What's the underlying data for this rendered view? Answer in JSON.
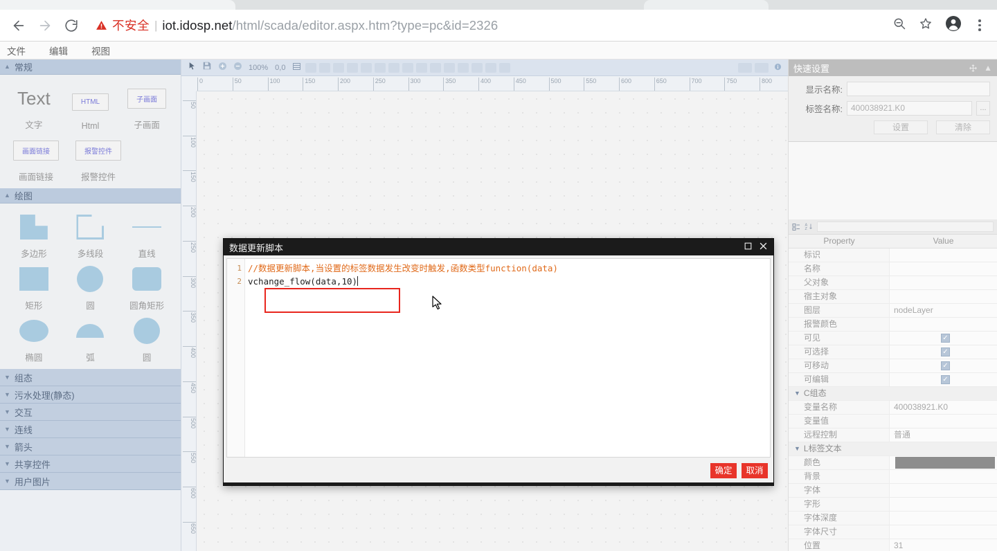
{
  "browser": {
    "back_icon": "arrow-left-icon",
    "forward_icon": "arrow-right-icon",
    "reload_icon": "reload-icon",
    "security_warning_icon": "warning-triangle-icon",
    "security_label": "不安全",
    "separator": "|",
    "url_host": "iot.idosp.net",
    "url_path": "/html/scada/editor.aspx.htm?type=pc&id=2326",
    "zoom_out_icon": "zoom-out-icon",
    "bookmark_icon": "star-icon",
    "profile_icon": "profile-avatar-icon",
    "menu_icon": "kebab-menu-icon"
  },
  "menubar": {
    "items": [
      {
        "label": "文件"
      },
      {
        "label": "编辑"
      },
      {
        "label": "视图"
      }
    ]
  },
  "palette": {
    "general": {
      "title": "常规",
      "expanded_icon": "triangle-up-icon",
      "rows": [
        [
          {
            "label": "文字",
            "glyph": "Text",
            "kind": "text"
          },
          {
            "label": "Html",
            "glyph": "HTML",
            "kind": "boxed"
          },
          {
            "label": "子画面",
            "glyph": "子画面",
            "kind": "boxed"
          }
        ],
        [
          {
            "label": "画面链接",
            "glyph": "画面链接",
            "kind": "boxed"
          },
          {
            "label": "报警控件",
            "glyph": "报警控件",
            "kind": "boxed"
          }
        ]
      ]
    },
    "drawing": {
      "title": "绘图",
      "expanded_icon": "triangle-up-icon",
      "rows": [
        [
          {
            "label": "多边形",
            "shape": "polygon"
          },
          {
            "label": "多线段",
            "shape": "polyline"
          },
          {
            "label": "直线",
            "shape": "line"
          }
        ],
        [
          {
            "label": "矩形",
            "shape": "rect"
          },
          {
            "label": "圆",
            "shape": "circle"
          },
          {
            "label": "圆角矩形",
            "shape": "roundrect"
          }
        ],
        [
          {
            "label": "椭圆",
            "shape": "ellipse"
          },
          {
            "label": "弧",
            "shape": "arc"
          },
          {
            "label": "圆",
            "shape": "circle"
          }
        ]
      ]
    },
    "collapsed_sections": [
      {
        "label": "组态",
        "icon": "triangle-down-icon"
      },
      {
        "label": "污水处理(静态)",
        "icon": "triangle-down-icon"
      },
      {
        "label": "交互",
        "icon": "triangle-down-icon"
      },
      {
        "label": "连线",
        "icon": "triangle-down-icon"
      },
      {
        "label": "箭头",
        "icon": "triangle-down-icon"
      },
      {
        "label": "共享控件",
        "icon": "triangle-down-icon"
      },
      {
        "label": "用户图片",
        "icon": "triangle-down-icon"
      }
    ]
  },
  "canvas": {
    "toolbar": {
      "select_icon": "cursor-arrow-icon",
      "save_icon": "save-icon",
      "zoom_in_icon": "zoom-in-icon",
      "zoom_out_icon": "zoom-out-icon",
      "zoom_level": "100%",
      "origin": "0,0",
      "grid_icon": "grid-icon",
      "info_icon": "info-icon"
    },
    "ruler": {
      "unit_step": 50,
      "h_ticks": [
        0,
        50,
        100,
        150,
        200,
        250,
        300,
        350,
        400,
        450,
        500,
        550,
        600,
        650,
        700,
        750,
        800
      ],
      "v_ticks": [
        50,
        100,
        150,
        200,
        250,
        300,
        350,
        400,
        450,
        500,
        550,
        600,
        650
      ]
    }
  },
  "quick_settings": {
    "title": "快速设置",
    "move_icon": "move-handle-icon",
    "collapse_icon": "triangle-up-icon",
    "display_name_label": "显示名称:",
    "display_name_value": "",
    "tag_name_label": "标签名称:",
    "tag_name_value": "400038921.K0",
    "browse_label": "...",
    "set_button": "设置",
    "clear_button": "清除"
  },
  "properties": {
    "toolbar": {
      "categorize_icon": "categorize-icon",
      "sort-az_icon": "sort-alphabetical-icon"
    },
    "header": {
      "property": "Property",
      "value": "Value"
    },
    "rows": [
      {
        "type": "row",
        "key": "标识",
        "value": ""
      },
      {
        "type": "row",
        "key": "名称",
        "value": ""
      },
      {
        "type": "row",
        "key": "父对象",
        "value": ""
      },
      {
        "type": "row",
        "key": "宿主对象",
        "value": ""
      },
      {
        "type": "row",
        "key": "图层",
        "value": "nodeLayer"
      },
      {
        "type": "row",
        "key": "报警颜色",
        "value": ""
      },
      {
        "type": "check",
        "key": "可见",
        "checked": true
      },
      {
        "type": "check",
        "key": "可选择",
        "checked": true
      },
      {
        "type": "check",
        "key": "可移动",
        "checked": true
      },
      {
        "type": "check",
        "key": "可编辑",
        "checked": true
      },
      {
        "type": "group",
        "key": "C组态",
        "icon": "triangle-down-icon"
      },
      {
        "type": "row",
        "key": "变量名称",
        "value": "400038921.K0"
      },
      {
        "type": "row",
        "key": "变量值",
        "value": ""
      },
      {
        "type": "row",
        "key": "远程控制",
        "value": "普通"
      },
      {
        "type": "group",
        "key": "L标签文本",
        "icon": "triangle-down-icon"
      },
      {
        "type": "swatch",
        "key": "颜色",
        "color": "#8d8d8d"
      },
      {
        "type": "row",
        "key": "背景",
        "value": ""
      },
      {
        "type": "row",
        "key": "字体",
        "value": ""
      },
      {
        "type": "row",
        "key": "字形",
        "value": ""
      },
      {
        "type": "row",
        "key": "字体深度",
        "value": ""
      },
      {
        "type": "row",
        "key": "字体尺寸",
        "value": ""
      },
      {
        "type": "row",
        "key": "位置",
        "value": "31"
      }
    ]
  },
  "script_dialog": {
    "title": "数据更新脚本",
    "maximize_icon": "maximize-icon",
    "close_icon": "close-icon",
    "line_numbers": [
      "1",
      "2"
    ],
    "code_line_1": "//数据更新脚本,当设置的标签数据发生改变时触发,函数类型function(data)",
    "code_line_2": "vchange_flow(data,10)",
    "ok_button": "确定",
    "cancel_button": "取消",
    "highlight_color": "#e8251d",
    "button_color": "#e8342a"
  },
  "cursor": {
    "icon": "arrow-cursor-icon"
  }
}
